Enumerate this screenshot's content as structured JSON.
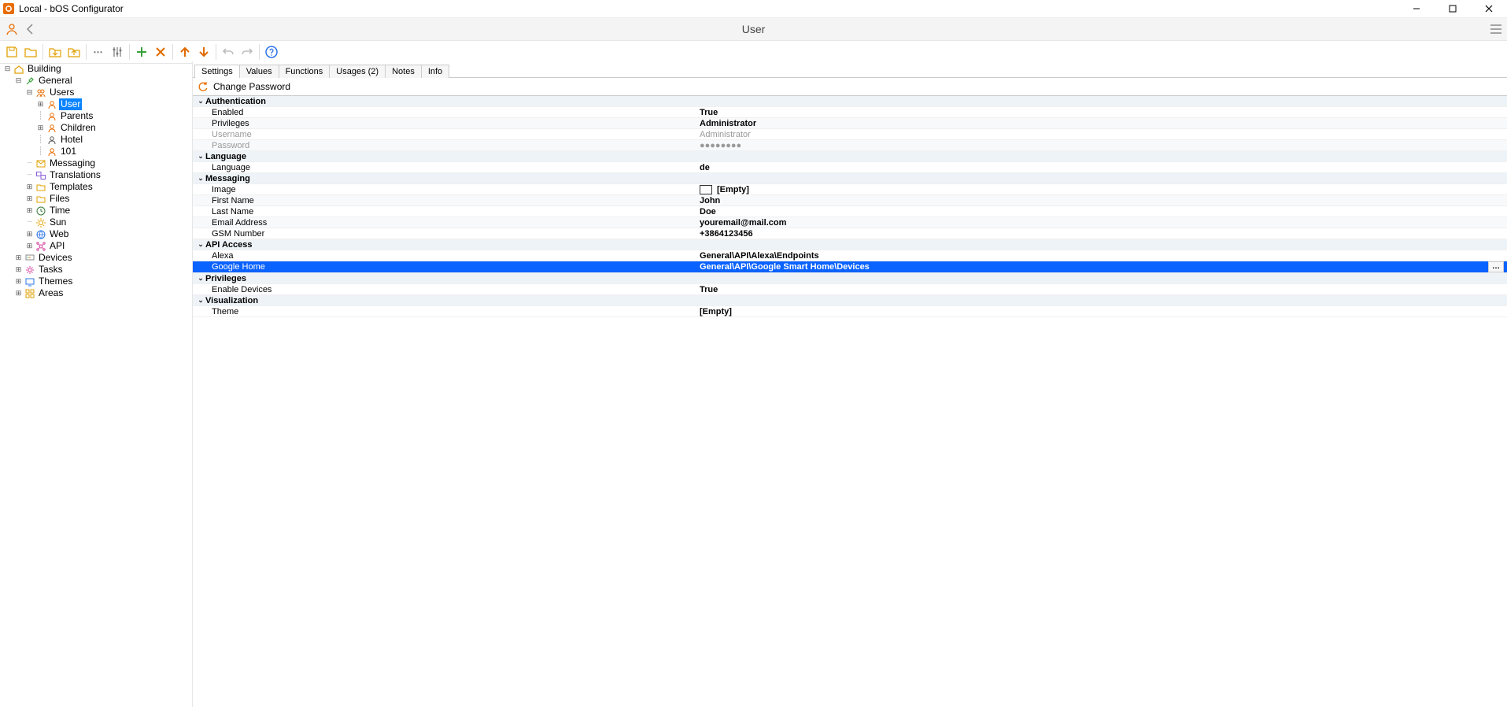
{
  "window": {
    "title": "Local - bOS Configurator"
  },
  "header": {
    "title": "User"
  },
  "tabs": [
    {
      "label": "Settings",
      "active": true
    },
    {
      "label": "Values",
      "active": false
    },
    {
      "label": "Functions",
      "active": false
    },
    {
      "label": "Usages (2)",
      "active": false
    },
    {
      "label": "Notes",
      "active": false
    },
    {
      "label": "Info",
      "active": false
    }
  ],
  "commandbar": {
    "change_password": "Change Password"
  },
  "tree": {
    "root": "Building",
    "general": "General",
    "users": "Users",
    "user": "User",
    "parents": "Parents",
    "children": "Children",
    "hotel": "Hotel",
    "hundredone": "101",
    "messaging": "Messaging",
    "translations": "Translations",
    "templates": "Templates",
    "files": "Files",
    "time": "Time",
    "sun": "Sun",
    "web": "Web",
    "api": "API",
    "devices": "Devices",
    "tasks": "Tasks",
    "themes": "Themes",
    "areas": "Areas"
  },
  "propgrid": {
    "authentication": {
      "label": "Authentication",
      "enabled": {
        "k": "Enabled",
        "v": "True"
      },
      "privileges": {
        "k": "Privileges",
        "v": "Administrator"
      },
      "username": {
        "k": "Username",
        "v": "Administrator"
      },
      "password": {
        "k": "Password",
        "v": "●●●●●●●●"
      }
    },
    "language": {
      "label": "Language",
      "language": {
        "k": "Language",
        "v": "de"
      }
    },
    "messaging": {
      "label": "Messaging",
      "image": {
        "k": "Image",
        "v": "[Empty]"
      },
      "first": {
        "k": "First Name",
        "v": "John"
      },
      "last": {
        "k": "Last Name",
        "v": "Doe"
      },
      "email": {
        "k": "Email Address",
        "v": "youremail@mail.com"
      },
      "gsm": {
        "k": "GSM Number",
        "v": "+3864123456"
      }
    },
    "api": {
      "label": "API Access",
      "alexa": {
        "k": "Alexa",
        "v": "General\\API\\Alexa\\Endpoints"
      },
      "google": {
        "k": "Google Home",
        "v": "General\\API\\Google Smart Home\\Devices"
      }
    },
    "privs": {
      "label": "Privileges",
      "enable_devices": {
        "k": "Enable Devices",
        "v": "True"
      }
    },
    "viz": {
      "label": "Visualization",
      "theme": {
        "k": "Theme",
        "v": "[Empty]"
      }
    }
  }
}
